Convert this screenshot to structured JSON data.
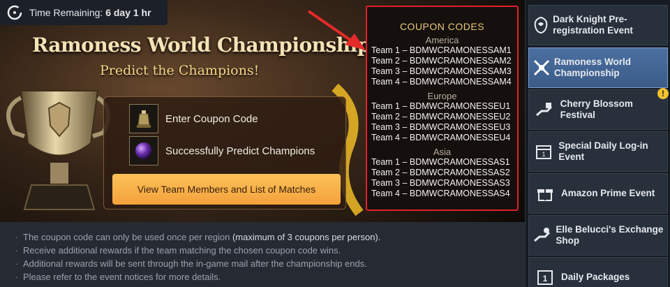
{
  "time": {
    "label": "Time Remaining:",
    "value": "6 day 1 hr"
  },
  "banner": {
    "title": "Ramoness World Championship",
    "subtitle": "Predict the Champions!"
  },
  "rewards": [
    {
      "icon": "bell-jar-item-icon",
      "label": "Enter Coupon Code"
    },
    {
      "icon": "purple-orb-item-icon",
      "label": "Successfully Predict Champions"
    }
  ],
  "view_button": "View Team Members and List of Matches",
  "coupons": {
    "title": "COUPON CODES",
    "regions": [
      {
        "name": "America",
        "codes": [
          "Team 1 – BDMWCRAMONESSAM1",
          "Team 2 – BDMWCRAMONESSAM2",
          "Team 3 – BDMWCRAMONESSAM3",
          "Team 4 – BDMWCRAMONESSAM4"
        ]
      },
      {
        "name": "Europe",
        "codes": [
          "Team 1 – BDMWCRAMONESSEU1",
          "Team 2 – BDMWCRAMONESSEU2",
          "Team 3 – BDMWCRAMONESSEU3",
          "Team 4 – BDMWCRAMONESSEU4"
        ]
      },
      {
        "name": "Asia",
        "codes": [
          "Team 1 – BDMWCRAMONESSAS1",
          "Team 2 – BDMWCRAMONESSAS2",
          "Team 3 – BDMWCRAMONESSAS3",
          "Team 4 – BDMWCRAMONESSAS4"
        ]
      }
    ]
  },
  "notes": [
    {
      "text": "The coupon code can only be used once per region ",
      "highlight": "(maximum of 3 coupons per person)."
    },
    {
      "text": "Receive additional rewards if the team matching the chosen coupon code wins.",
      "highlight": ""
    },
    {
      "text": "Additional rewards will be sent through the in-game mail after the championship ends.",
      "highlight": ""
    },
    {
      "text": "Please refer to the event notices for more details.",
      "highlight": ""
    }
  ],
  "sidebar": {
    "items": [
      {
        "label": "Dark Knight Pre-registration Event",
        "icon": "knight-emblem-icon",
        "active": false,
        "alert": ""
      },
      {
        "label": "Ramoness World Championship",
        "icon": "crossed-swords-icon",
        "active": true,
        "alert": ""
      },
      {
        "label": "Cherry Blossom Festival",
        "icon": "hand-gift-icon",
        "active": false,
        "alert": "!"
      },
      {
        "label": "Special Daily Log-in Event",
        "icon": "calendar-icon",
        "active": false,
        "alert": ""
      },
      {
        "label": "Amazon Prime Event",
        "icon": "gift-box-icon",
        "active": false,
        "alert": ""
      },
      {
        "label": "Elle Belucci's Exchange Shop",
        "icon": "hand-exchange-icon",
        "active": false,
        "alert": ""
      },
      {
        "label": "Daily Packages",
        "icon": "calendar-1-icon",
        "active": false,
        "alert": ""
      }
    ]
  },
  "colors": {
    "accent": "#f4a13c",
    "coupon_border": "#e0202a",
    "active_tab": "#4a6fa0"
  }
}
